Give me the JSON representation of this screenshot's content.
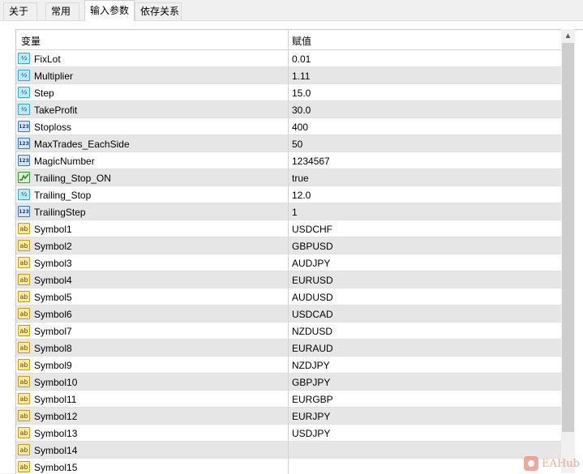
{
  "tabs": [
    {
      "label": "关于",
      "active": false
    },
    {
      "label": "常用",
      "active": false
    },
    {
      "label": "输入参数",
      "active": true
    },
    {
      "label": "依存关系",
      "active": false
    }
  ],
  "table": {
    "headers": {
      "variable": "变量",
      "value": "赋值"
    },
    "rows": [
      {
        "type": "double",
        "icon_text": "½",
        "name": "FixLot",
        "value": "0.01"
      },
      {
        "type": "double",
        "icon_text": "½",
        "name": "Multiplier",
        "value": "1.11"
      },
      {
        "type": "double",
        "icon_text": "½",
        "name": "Step",
        "value": "15.0"
      },
      {
        "type": "double",
        "icon_text": "½",
        "name": "TakeProfit",
        "value": "30.0"
      },
      {
        "type": "int",
        "icon_text": "123",
        "name": "Stoploss",
        "value": "400"
      },
      {
        "type": "int",
        "icon_text": "123",
        "name": "MaxTrades_EachSide",
        "value": "50"
      },
      {
        "type": "int",
        "icon_text": "123",
        "name": "MagicNumber",
        "value": "1234567"
      },
      {
        "type": "bool",
        "icon_text": "",
        "name": "Trailing_Stop_ON",
        "value": "true"
      },
      {
        "type": "double",
        "icon_text": "½",
        "name": "Trailing_Stop",
        "value": "12.0"
      },
      {
        "type": "int",
        "icon_text": "123",
        "name": "TrailingStep",
        "value": "1"
      },
      {
        "type": "string",
        "icon_text": "ab",
        "name": "Symbol1",
        "value": "USDCHF"
      },
      {
        "type": "string",
        "icon_text": "ab",
        "name": "Symbol2",
        "value": "GBPUSD"
      },
      {
        "type": "string",
        "icon_text": "ab",
        "name": "Symbol3",
        "value": "AUDJPY"
      },
      {
        "type": "string",
        "icon_text": "ab",
        "name": "Symbol4",
        "value": "EURUSD"
      },
      {
        "type": "string",
        "icon_text": "ab",
        "name": "Symbol5",
        "value": "AUDUSD"
      },
      {
        "type": "string",
        "icon_text": "ab",
        "name": "Symbol6",
        "value": "USDCAD"
      },
      {
        "type": "string",
        "icon_text": "ab",
        "name": "Symbol7",
        "value": "NZDUSD"
      },
      {
        "type": "string",
        "icon_text": "ab",
        "name": "Symbol8",
        "value": "EURAUD"
      },
      {
        "type": "string",
        "icon_text": "ab",
        "name": "Symbol9",
        "value": "NZDJPY"
      },
      {
        "type": "string",
        "icon_text": "ab",
        "name": "Symbol10",
        "value": "GBPJPY"
      },
      {
        "type": "string",
        "icon_text": "ab",
        "name": "Symbol11",
        "value": "EURGBP"
      },
      {
        "type": "string",
        "icon_text": "ab",
        "name": "Symbol12",
        "value": "EURJPY"
      },
      {
        "type": "string",
        "icon_text": "ab",
        "name": "Symbol13",
        "value": "USDJPY"
      },
      {
        "type": "string",
        "icon_text": "ab",
        "name": "Symbol14",
        "value": ""
      },
      {
        "type": "string",
        "icon_text": "ab",
        "name": "Symbol15",
        "value": ""
      }
    ]
  },
  "watermark": {
    "text": "EAHub"
  },
  "colors": {
    "row_alt": "#e6e6e6",
    "watermark": "#f08a7a"
  }
}
